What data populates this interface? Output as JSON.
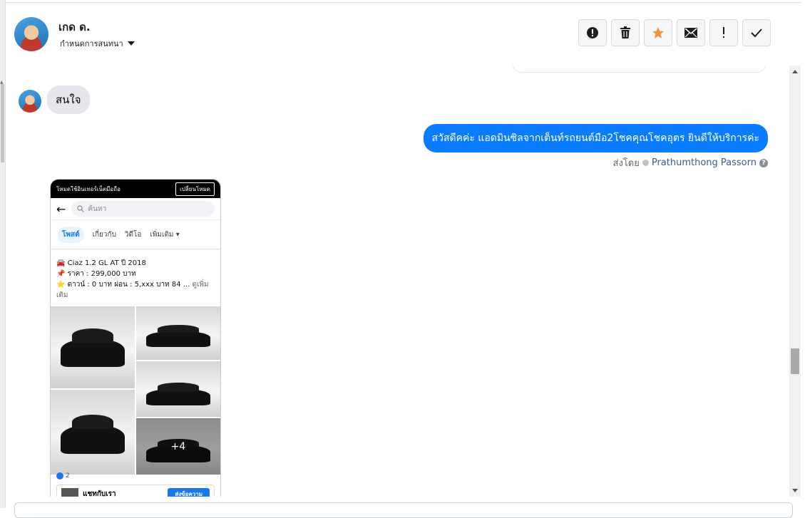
{
  "header": {
    "contact_name": "เกด ด.",
    "assign_label": "กำหนดการสนทนา"
  },
  "actions": [
    {
      "name": "mark-spam-button",
      "icon": "alert-circle-icon"
    },
    {
      "name": "delete-button",
      "icon": "trash-icon"
    },
    {
      "name": "star-button",
      "icon": "star-icon"
    },
    {
      "name": "mark-unread-button",
      "icon": "envelope-icon"
    },
    {
      "name": "follow-up-button",
      "icon": "exclamation-icon"
    },
    {
      "name": "mark-done-button",
      "icon": "checkmark-icon"
    }
  ],
  "messages": {
    "incoming_text": "สนใจ",
    "outgoing_text": "สวัสดีคค่ะ แอดมินซิลจากเต็นท์รถยนต์มือ2โชคคุณโชคอุตร ยินดีให้บริการค่ะ",
    "sent_by_label": "ส่งโดย",
    "sent_by_name": "Prathumthong Passorn"
  },
  "screenshot": {
    "top_banner": "โหมดใช้อินเทอร์เน็ตมือถือ",
    "mode_button": "เปลี่ยนโหมด",
    "search_placeholder": "ค้นหา",
    "tabs": [
      "โพสต์",
      "เกี่ยวกับ",
      "วิดีโอ",
      "เพิ่มเติม"
    ],
    "post_line1": "🚘 Ciaz 1.2 GL AT ปี 2018",
    "post_line2": "📌 ราคา : 299,000 บาท",
    "post_line3": "⭐ ดาวน์ : 0 บาท ผ่อน : 5,xxx บาท 84 ...",
    "see_more": "ดูเพิ่มเติม",
    "more_photos": "+4",
    "like_count": "2",
    "chat_label": "แชทกับเรา",
    "send_message_button": "ส่งข้อความ"
  },
  "colors": {
    "accent": "#0a7cff",
    "star": "#f7923b",
    "incoming_bubble": "#e4e6eb"
  }
}
